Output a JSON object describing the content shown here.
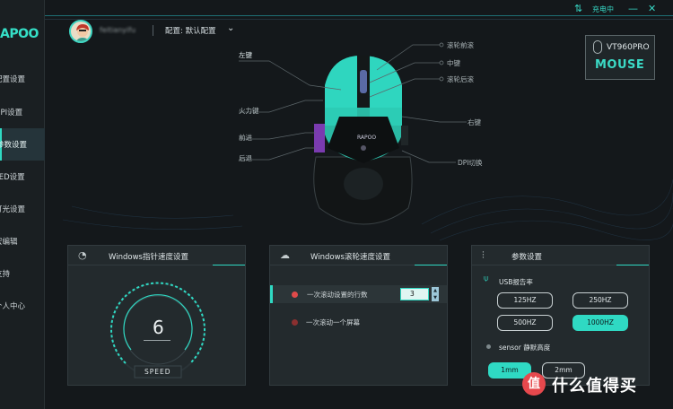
{
  "sidebar": {
    "logo": "APOO",
    "items": [
      {
        "label": "配置设置"
      },
      {
        "label": "DPI设置"
      },
      {
        "label": "参数设置"
      },
      {
        "label": "LED设置"
      },
      {
        "label": "灯光设置"
      },
      {
        "label": "宏编辑"
      },
      {
        "label": "支持"
      },
      {
        "label": "个人中心"
      }
    ]
  },
  "topbar": {
    "charge_status": "充电中",
    "minimize": "—",
    "close": "✕"
  },
  "header": {
    "username": "feitianyifu",
    "config_label": "配置: 默认配置"
  },
  "device": {
    "model": "VT960PRO",
    "type": "MOUSE"
  },
  "callouts": {
    "left_key": "左键",
    "fire_key": "火力键",
    "forward": "前进",
    "back": "后退",
    "wheel_forward": "滚轮前滚",
    "middle_key": "中键",
    "wheel_back": "滚轮后滚",
    "right_key": "右键",
    "dpi_switch": "DPI切换"
  },
  "pointer_panel": {
    "title": "Windows指针速度设置",
    "value": "6",
    "label": "SPEED"
  },
  "wheel_panel": {
    "title": "Windows滚轮速度设置",
    "options": [
      {
        "text": "一次滚动设置的行数",
        "value": "3"
      },
      {
        "text": "一次滚动一个屏幕"
      }
    ]
  },
  "params_panel": {
    "title": "参数设置",
    "usb_label": "USB报告率",
    "rates": [
      "125HZ",
      "250HZ",
      "500HZ",
      "1000HZ"
    ],
    "selected_rate": "1000HZ",
    "sensor_label": "sensor 静默高度",
    "heights": [
      "1mm",
      "2mm"
    ],
    "selected_height": "1mm"
  },
  "watermark": "值 什么值得买"
}
